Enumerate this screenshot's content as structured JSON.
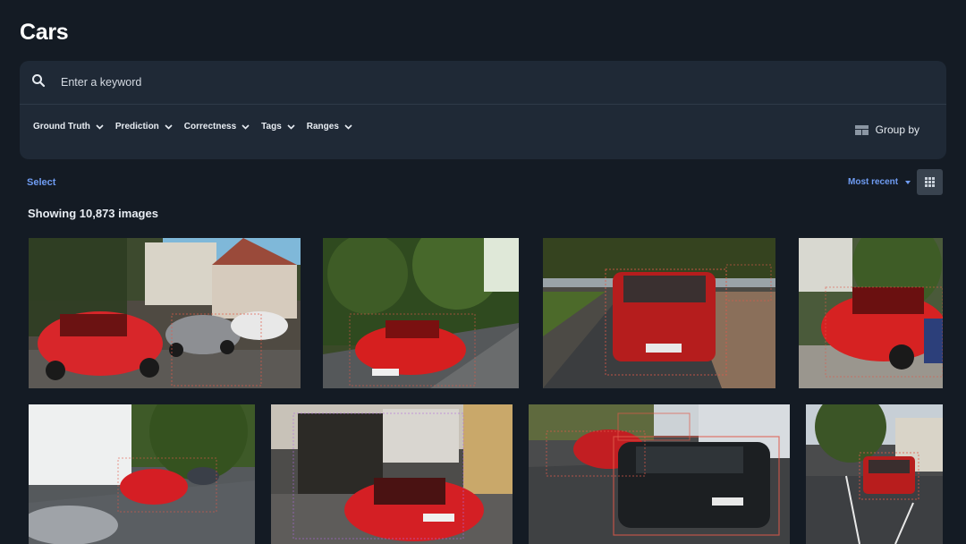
{
  "page": {
    "title": "Cars"
  },
  "search": {
    "placeholder": "Enter a keyword",
    "value": ""
  },
  "filters": [
    {
      "label": "Ground Truth"
    },
    {
      "label": "Prediction"
    },
    {
      "label": "Correctness"
    },
    {
      "label": "Tags"
    },
    {
      "label": "Ranges"
    }
  ],
  "group_by": {
    "label": "Group by",
    "icon": "table-view-icon"
  },
  "toolbar": {
    "select_label": "Select",
    "sort_label": "Most recent",
    "view_icon": "grid-view-icon"
  },
  "results": {
    "showing_text": "Showing 10,873 images"
  },
  "colors": {
    "background": "#141b24",
    "panel": "#1f2936",
    "accent": "#6f9cf2",
    "annotation_box": "#e05a4a"
  }
}
